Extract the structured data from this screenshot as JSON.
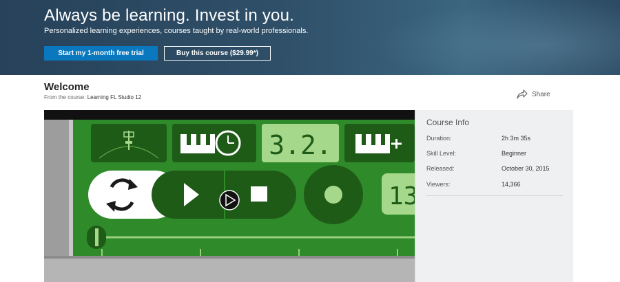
{
  "hero": {
    "title": "Always be learning. Invest in you.",
    "subtitle": "Personalized learning experiences, courses taught by real-world professionals.",
    "trial_button": "Start my 1-month free trial",
    "buy_button": "Buy this course ($29.99*)"
  },
  "page": {
    "title": "Welcome",
    "from_label": "From the course:",
    "course_name": "Learning FL Studio 12",
    "share_label": "Share"
  },
  "video": {
    "counter_text": "3.2.",
    "right_partial_text": "13"
  },
  "course_info": {
    "title": "Course Info",
    "rows": [
      {
        "label": "Duration:",
        "value": "2h 3m 35s"
      },
      {
        "label": "Skill Level:",
        "value": "Beginner"
      },
      {
        "label": "Released:",
        "value": "October 30, 2015"
      },
      {
        "label": "Viewers:",
        "value": "14,366"
      }
    ]
  },
  "colors": {
    "hero_bg": "#2f4f68",
    "primary_button": "#0a78bf",
    "video_green": "#2f8a2a",
    "dark_green": "#1e5b17",
    "light_green": "#a6d88c"
  }
}
